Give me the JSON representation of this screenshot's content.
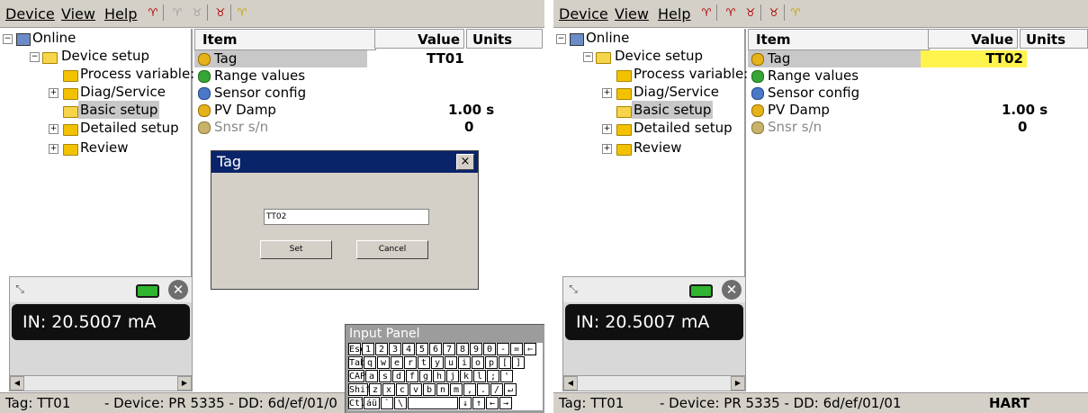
{
  "left": {
    "menu": [
      "Device",
      "View",
      "Help"
    ],
    "tree": {
      "root": "Online",
      "device_setup": "Device setup",
      "process_variables": "Process variable:",
      "diag_service": "Diag/Service",
      "basic_setup": "Basic setup",
      "detailed_setup": "Detailed setup",
      "review": "Review"
    },
    "grid": {
      "headers": {
        "item": "Item",
        "value": "Value",
        "units": "Units"
      },
      "rows": [
        {
          "item": "Tag",
          "value": "TT01"
        },
        {
          "item": "Range values",
          "value": ""
        },
        {
          "item": "Sensor config",
          "value": ""
        },
        {
          "item": "PV Damp",
          "value": "1.00 s"
        },
        {
          "item": "Snsr s/n",
          "value": "0"
        }
      ]
    },
    "dialog": {
      "title": "Tag",
      "close": "×",
      "input_value": "TT02",
      "set": "Set",
      "cancel": "Cancel"
    },
    "gadget": {
      "display": "IN: 20.5007 mA"
    },
    "status": {
      "tag": "Tag: TT01",
      "device": "- Device: PR 5335 - DD: 6d/ef/01/0"
    },
    "input_panel": {
      "title": "Input Panel",
      "rows": [
        [
          "Esc",
          "1",
          "2",
          "3",
          "4",
          "5",
          "6",
          "7",
          "8",
          "9",
          "0",
          "-",
          "=",
          "⇐"
        ],
        [
          "Tab",
          "q",
          "w",
          "e",
          "r",
          "t",
          "y",
          "u",
          "i",
          "o",
          "p",
          "[",
          "]"
        ],
        [
          "CAP",
          "a",
          "s",
          "d",
          "f",
          "g",
          "h",
          "j",
          "k",
          "l",
          ";",
          "'"
        ],
        [
          "Shift",
          "z",
          "x",
          "c",
          "v",
          "b",
          "n",
          "m",
          ",",
          ".",
          "/",
          "↵"
        ],
        [
          "Ctl",
          "áü",
          "`",
          "\\",
          "",
          "↓",
          "↑",
          "←",
          "→"
        ]
      ]
    }
  },
  "right": {
    "menu": [
      "Device",
      "View",
      "Help"
    ],
    "tree": {
      "root": "Online",
      "device_setup": "Device setup",
      "process_variables": "Process variable:",
      "diag_service": "Diag/Service",
      "basic_setup": "Basic setup",
      "detailed_setup": "Detailed setup",
      "review": "Review"
    },
    "grid": {
      "headers": {
        "item": "Item",
        "value": "Value",
        "units": "Units"
      },
      "rows": [
        {
          "item": "Tag",
          "value": "TT02"
        },
        {
          "item": "Range values",
          "value": ""
        },
        {
          "item": "Sensor config",
          "value": ""
        },
        {
          "item": "PV Damp",
          "value": "1.00 s"
        },
        {
          "item": "Snsr s/n",
          "value": "0"
        }
      ]
    },
    "gadget": {
      "display": "IN: 20.5007 mA"
    },
    "status": {
      "tag": "Tag: TT01",
      "device": "- Device: PR 5335 - DD: 6d/ef/01/01",
      "protocol": "HART"
    }
  },
  "colors": {
    "highlight": "#fff34d",
    "dialog_title": "#0a246a",
    "selection": "#c8c8c8"
  }
}
